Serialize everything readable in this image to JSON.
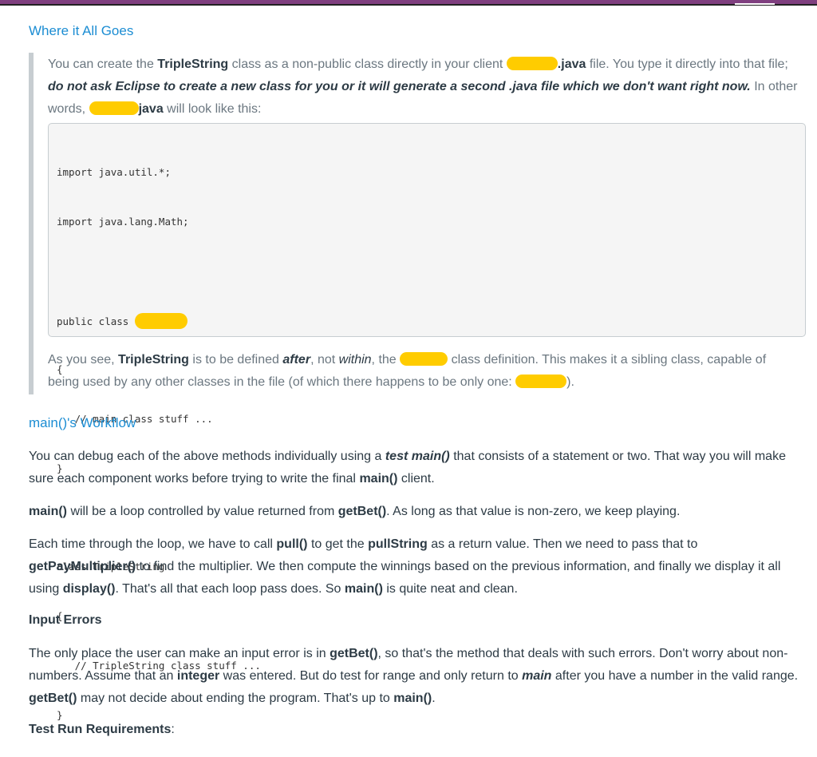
{
  "header": {
    "accent_color": "#7f3f7f"
  },
  "section1": {
    "heading": "Where it All Goes",
    "intro": {
      "t1": "You can create the ",
      "b1": "TripleString",
      "t2": " class as a non-public class directly in your client ",
      "b2": ".java",
      "t3": " file. You type it directly into that file; ",
      "i1": "do not ask Eclipse to create a new class for you or it will generate a second .java file which we don't want right now.",
      "t4": " In other words, ",
      "b3": "java",
      "t5": " will look like this:"
    },
    "code_lines": [
      "import java.util.*;",
      "import java.lang.Math;",
      "",
      "public class ",
      "{",
      "   // main class stuff ...",
      "}",
      "",
      "class TripleString",
      "{",
      "   // TripleString class stuff ...",
      "}"
    ],
    "after": {
      "t1": "As you see, ",
      "b1": "TripleString",
      "t2": " is to be defined ",
      "i1": "after",
      "t3": ", not ",
      "i2": "within",
      "t4": ", the ",
      "t5": " class definition. This makes it a sibling class, capable of being used by any other classes in the file  (of which there happens to be only one: ",
      "t6": ")."
    }
  },
  "section2": {
    "heading": "main()'s Workflow",
    "p1": {
      "t1": "You can debug each of the above methods individually using a ",
      "bi1": "test main()",
      "t2": " that consists of a statement or two.  That way you will make sure each component works before trying to write the final ",
      "b1": "main()",
      "t3": " client."
    },
    "p2": {
      "b1": "main()",
      "t1": " will be a loop controlled by value returned from ",
      "b2": "getBet()",
      "t2": ".  As long as that value is non-zero, we keep playing."
    },
    "p3": {
      "t1": "Each time through the loop, we have to call ",
      "b1": "pull()",
      "t2": " to get the ",
      "b2": "pullString",
      "t3": " as a return value. Then we need to pass that to ",
      "b3": "getPayMultiplier()",
      "t4": " to find the multiplier.  We then compute the winnings based on the previous information, and finally we display it all using ",
      "b4": "display()",
      "t5": ".  That's all that each loop pass does.  So ",
      "b5": "main()",
      "t6": " is quite neat and clean."
    }
  },
  "section3": {
    "heading": "Input Errors",
    "p1": {
      "t1": "The only place the user can make an input error is in ",
      "b1": "getBet()",
      "t2": ", so that's the method that deals with such errors.  Don't worry about non-numbers.  Assume that an ",
      "b2": "integer",
      "t3": " was entered.  But do test for range and only return to ",
      "bi1": "main",
      "t4": " after you have a number in the valid range. ",
      "b3": "getBet()",
      "t5": " may not decide about ending the program.  That's up to ",
      "b4": "main()",
      "t6": "."
    }
  },
  "section4": {
    "heading": "Test Run Requirements",
    "suffix": ":"
  }
}
